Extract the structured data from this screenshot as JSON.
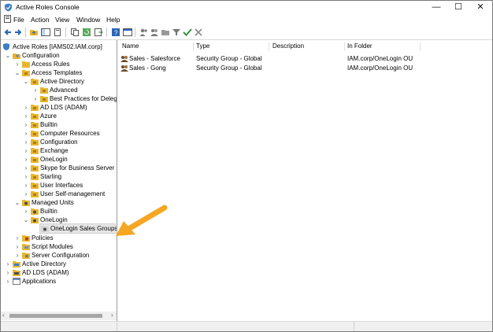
{
  "window": {
    "title": "Active Roles Console"
  },
  "menu": [
    "File",
    "Action",
    "View",
    "Window",
    "Help"
  ],
  "window_buttons": {
    "minimize": "—",
    "maximize": "☐",
    "close": "✕"
  },
  "colors": {
    "accent": "#f5a623",
    "folder": "#e8b62e",
    "selection": "#e6e6e6"
  },
  "tree": {
    "root": "Active Roles [IAMS02.IAM.corp]",
    "configuration": "Configuration",
    "access_rules": "Access Rules",
    "access_templates": "Access Templates",
    "active_directory_tpl": "Active Directory",
    "advanced": "Advanced",
    "best_practices": "Best Practices for Delega",
    "ad_lds_tpl": "AD LDS (ADAM)",
    "azure": "Azure",
    "builtin_tpl": "Builtin",
    "computer_resources": "Computer Resources",
    "configuration_tpl": "Configuration",
    "exchange": "Exchange",
    "onelogin_tpl": "OneLogin",
    "skype": "Skype for Business Server",
    "starling": "Starling",
    "user_interfaces": "User Interfaces",
    "user_self_management": "User Self-management",
    "managed_units": "Managed Units",
    "builtin_mu": "Builtin",
    "onelogin_mu": "OneLogin",
    "onelogin_sales_groups": "OneLogin Sales Groups",
    "policies": "Policies",
    "script_modules": "Script Modules",
    "server_configuration": "Server Configuration",
    "active_directory": "Active Directory",
    "ad_lds": "AD LDS (ADAM)",
    "applications": "Applications"
  },
  "list": {
    "columns": [
      "Name",
      "Type",
      "Description",
      "In Folder"
    ],
    "rows": [
      {
        "name": "Sales - Salesforce",
        "type": "Security Group - Global",
        "description": "",
        "folder": "IAM.corp/OneLogin OU"
      },
      {
        "name": "Sales - Gong",
        "type": "Security Group - Global",
        "description": "",
        "folder": "IAM.corp/OneLogin OU"
      }
    ]
  }
}
